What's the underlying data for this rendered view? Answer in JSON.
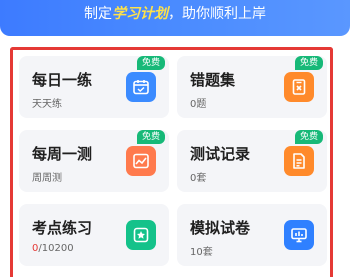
{
  "banner": {
    "prefix": "制定",
    "highlight": "学习计划",
    "suffix": "，助你顺利上岸"
  },
  "colors": {
    "banner_blue": "#3d7bff",
    "highlight_yellow": "#ffe24a",
    "frame_red": "#e53935",
    "badge_green": "#17b978",
    "icon_blue": "#3b8bff",
    "icon_orange": "#ff8a2b",
    "icon_orange_light": "#ff7a4d",
    "icon_green": "#14c28a",
    "icon_blue_dark": "#2f80ff"
  },
  "cards": [
    {
      "title": "每日一练",
      "sub": "天天练",
      "badge": "免费",
      "icon": "calendar-icon"
    },
    {
      "title": "错题集",
      "sub": "0题",
      "badge": "免费",
      "icon": "wrong-question-icon"
    },
    {
      "title": "每周一测",
      "sub": "周周测",
      "badge": "免费",
      "icon": "chart-icon"
    },
    {
      "title": "测试记录",
      "sub": "0套",
      "badge": "免费",
      "icon": "record-icon"
    },
    {
      "title": "考点练习",
      "sub_done": "0",
      "sub_total": "/10200",
      "icon": "knowledge-point-icon"
    },
    {
      "title": "模拟试卷",
      "sub": "10套",
      "icon": "mock-exam-icon"
    }
  ]
}
